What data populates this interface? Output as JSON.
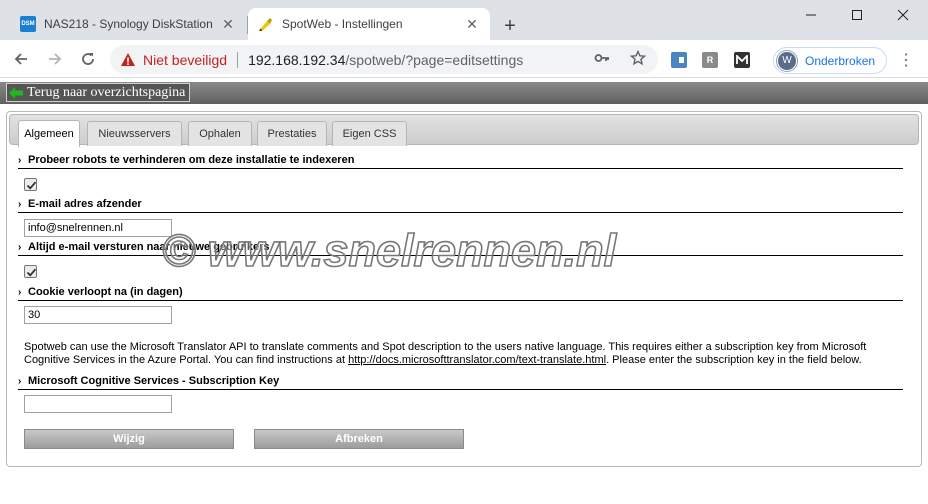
{
  "browser": {
    "tabs": [
      {
        "title": "NAS218 - Synology DiskStation",
        "favicon": "DSM",
        "active": false
      },
      {
        "title": "SpotWeb - Instellingen",
        "active": true
      }
    ],
    "address": {
      "security_label": "Niet beveiligd",
      "url_host": "192.168.192.34",
      "url_path": "/spotweb/?page=editsettings"
    },
    "extensions": [
      "R"
    ],
    "profile": {
      "initial": "W",
      "label": "Onderbroken"
    }
  },
  "page": {
    "back_link": "Terug naar overzichtspagina",
    "tabs": [
      "Algemeen",
      "Nieuwsservers",
      "Ophalen",
      "Prestaties",
      "Eigen CSS"
    ],
    "sections": {
      "robots_title": "Probeer robots te verhinderen om deze installatie te indexeren",
      "robots_checked": true,
      "email_title": "E-mail adres afzender",
      "email_value": "info@snelrennen.nl",
      "send_mail_title": "Altijd e-mail versturen naar nieuwe gebruikers",
      "send_mail_checked": true,
      "cookie_title": "Cookie verloopt na (in dagen)",
      "cookie_value": "30",
      "translator_text_1": "Spotweb can use the Microsoft Translator API to translate comments and Spot description to the users native language. This requires either a subscription key from Microsoft Cognitive Services in the Azure Portal. You can find instructions at ",
      "translator_link": "http://docs.microsofttranslator.com/text-translate.html",
      "translator_text_2": ". Please enter the subscription key in the field below.",
      "subscription_title": "Microsoft Cognitive Services - Subscription Key",
      "subscription_value": ""
    },
    "buttons": {
      "save": "Wijzig",
      "cancel": "Afbreken"
    },
    "watermark": "© www.snelrennen.nl"
  },
  "colors": {
    "insecure": "#c5221f",
    "profile": "#1a73e8",
    "button": "#b0b0b0"
  }
}
